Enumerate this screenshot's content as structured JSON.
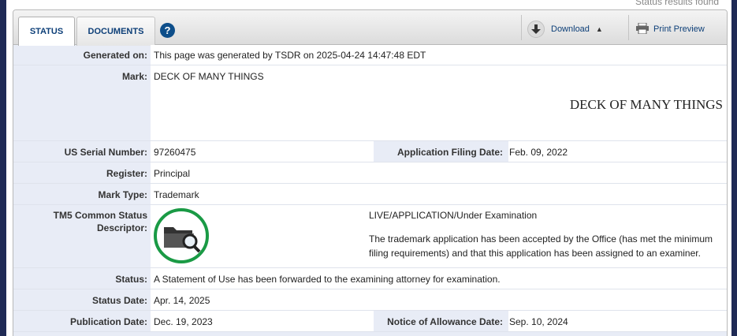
{
  "header": {
    "status_found": "Status results found"
  },
  "tabs": [
    {
      "label": "STATUS"
    },
    {
      "label": "DOCUMENTS"
    }
  ],
  "toolbar": {
    "help_glyph": "?",
    "download_label": "Download",
    "print_label": "Print Preview"
  },
  "fields": {
    "generated_on": {
      "label": "Generated on:",
      "value": "This page was generated by TSDR on 2025-04-24 14:47:48 EDT"
    },
    "mark": {
      "label": "Mark:",
      "value": "DECK OF MANY THINGS",
      "image_text": "DECK OF MANY THINGS"
    },
    "serial": {
      "label": "US Serial Number:",
      "value": "97260475"
    },
    "filing_date": {
      "label": "Application Filing Date:",
      "value": "Feb. 09, 2022"
    },
    "register": {
      "label": "Register:",
      "value": "Principal"
    },
    "mark_type": {
      "label": "Mark Type:",
      "value": "Trademark"
    },
    "tm5": {
      "label_line1": "TM5 Common Status",
      "label_line2": "Descriptor:",
      "status": "LIVE/APPLICATION/Under Examination",
      "description": "The trademark application has been accepted by the Office (has met the minimum filing requirements) and that this application has been assigned to an examiner.",
      "icon": "folder-magnifier-icon"
    },
    "status": {
      "label": "Status:",
      "value": "A Statement of Use has been forwarded to the examining attorney for examination."
    },
    "status_date": {
      "label": "Status Date:",
      "value": "Apr. 14, 2025"
    },
    "publication_date": {
      "label": "Publication Date:",
      "value": "Dec. 19, 2023"
    },
    "allowance_date": {
      "label": "Notice of Allowance Date:",
      "value": "Sep. 10, 2024"
    }
  },
  "colors": {
    "accent": "#0d3f78",
    "status_ring": "#1a9a45",
    "label_bg": "#e8ecf6"
  }
}
